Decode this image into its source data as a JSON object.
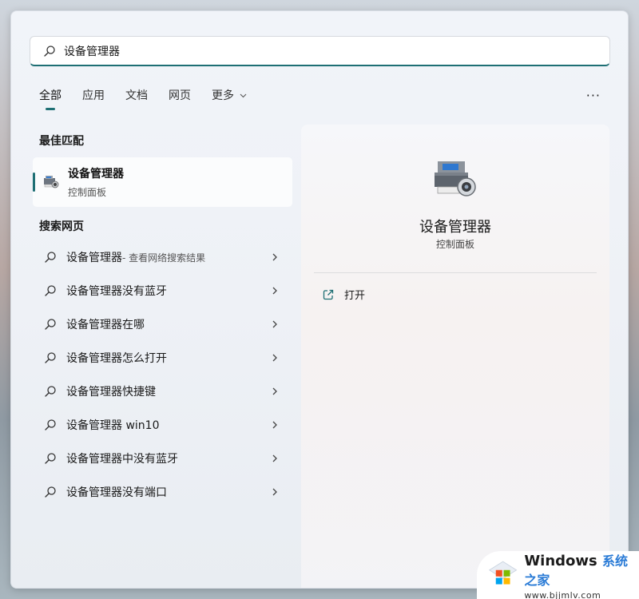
{
  "search": {
    "value": "设备管理器"
  },
  "tabs": [
    {
      "label": "全部",
      "active": true
    },
    {
      "label": "应用"
    },
    {
      "label": "文档"
    },
    {
      "label": "网页"
    },
    {
      "label": "更多"
    }
  ],
  "more_menu": "···",
  "best_match": {
    "section_title": "最佳匹配",
    "title": "设备管理器",
    "subtitle": "控制面板"
  },
  "web_search": {
    "section_title": "搜索网页",
    "items": [
      {
        "label": "设备管理器",
        "suffix": " - 查看网络搜索结果"
      },
      {
        "label": "设备管理器没有蓝牙"
      },
      {
        "label": "设备管理器在哪"
      },
      {
        "label": "设备管理器怎么打开"
      },
      {
        "label": "设备管理器快捷键"
      },
      {
        "label": "设备管理器 win10"
      },
      {
        "label": "设备管理器中没有蓝牙"
      },
      {
        "label": "设备管理器没有端口"
      }
    ]
  },
  "detail": {
    "title": "设备管理器",
    "subtitle": "控制面板",
    "open_label": "打开"
  },
  "watermark": {
    "brand": "Windows",
    "brand_cn": "系统之家",
    "url": "www.bjjmlv.com"
  },
  "colors": {
    "accent": "#1e6f74",
    "panel_bg": "#eef1f6"
  }
}
